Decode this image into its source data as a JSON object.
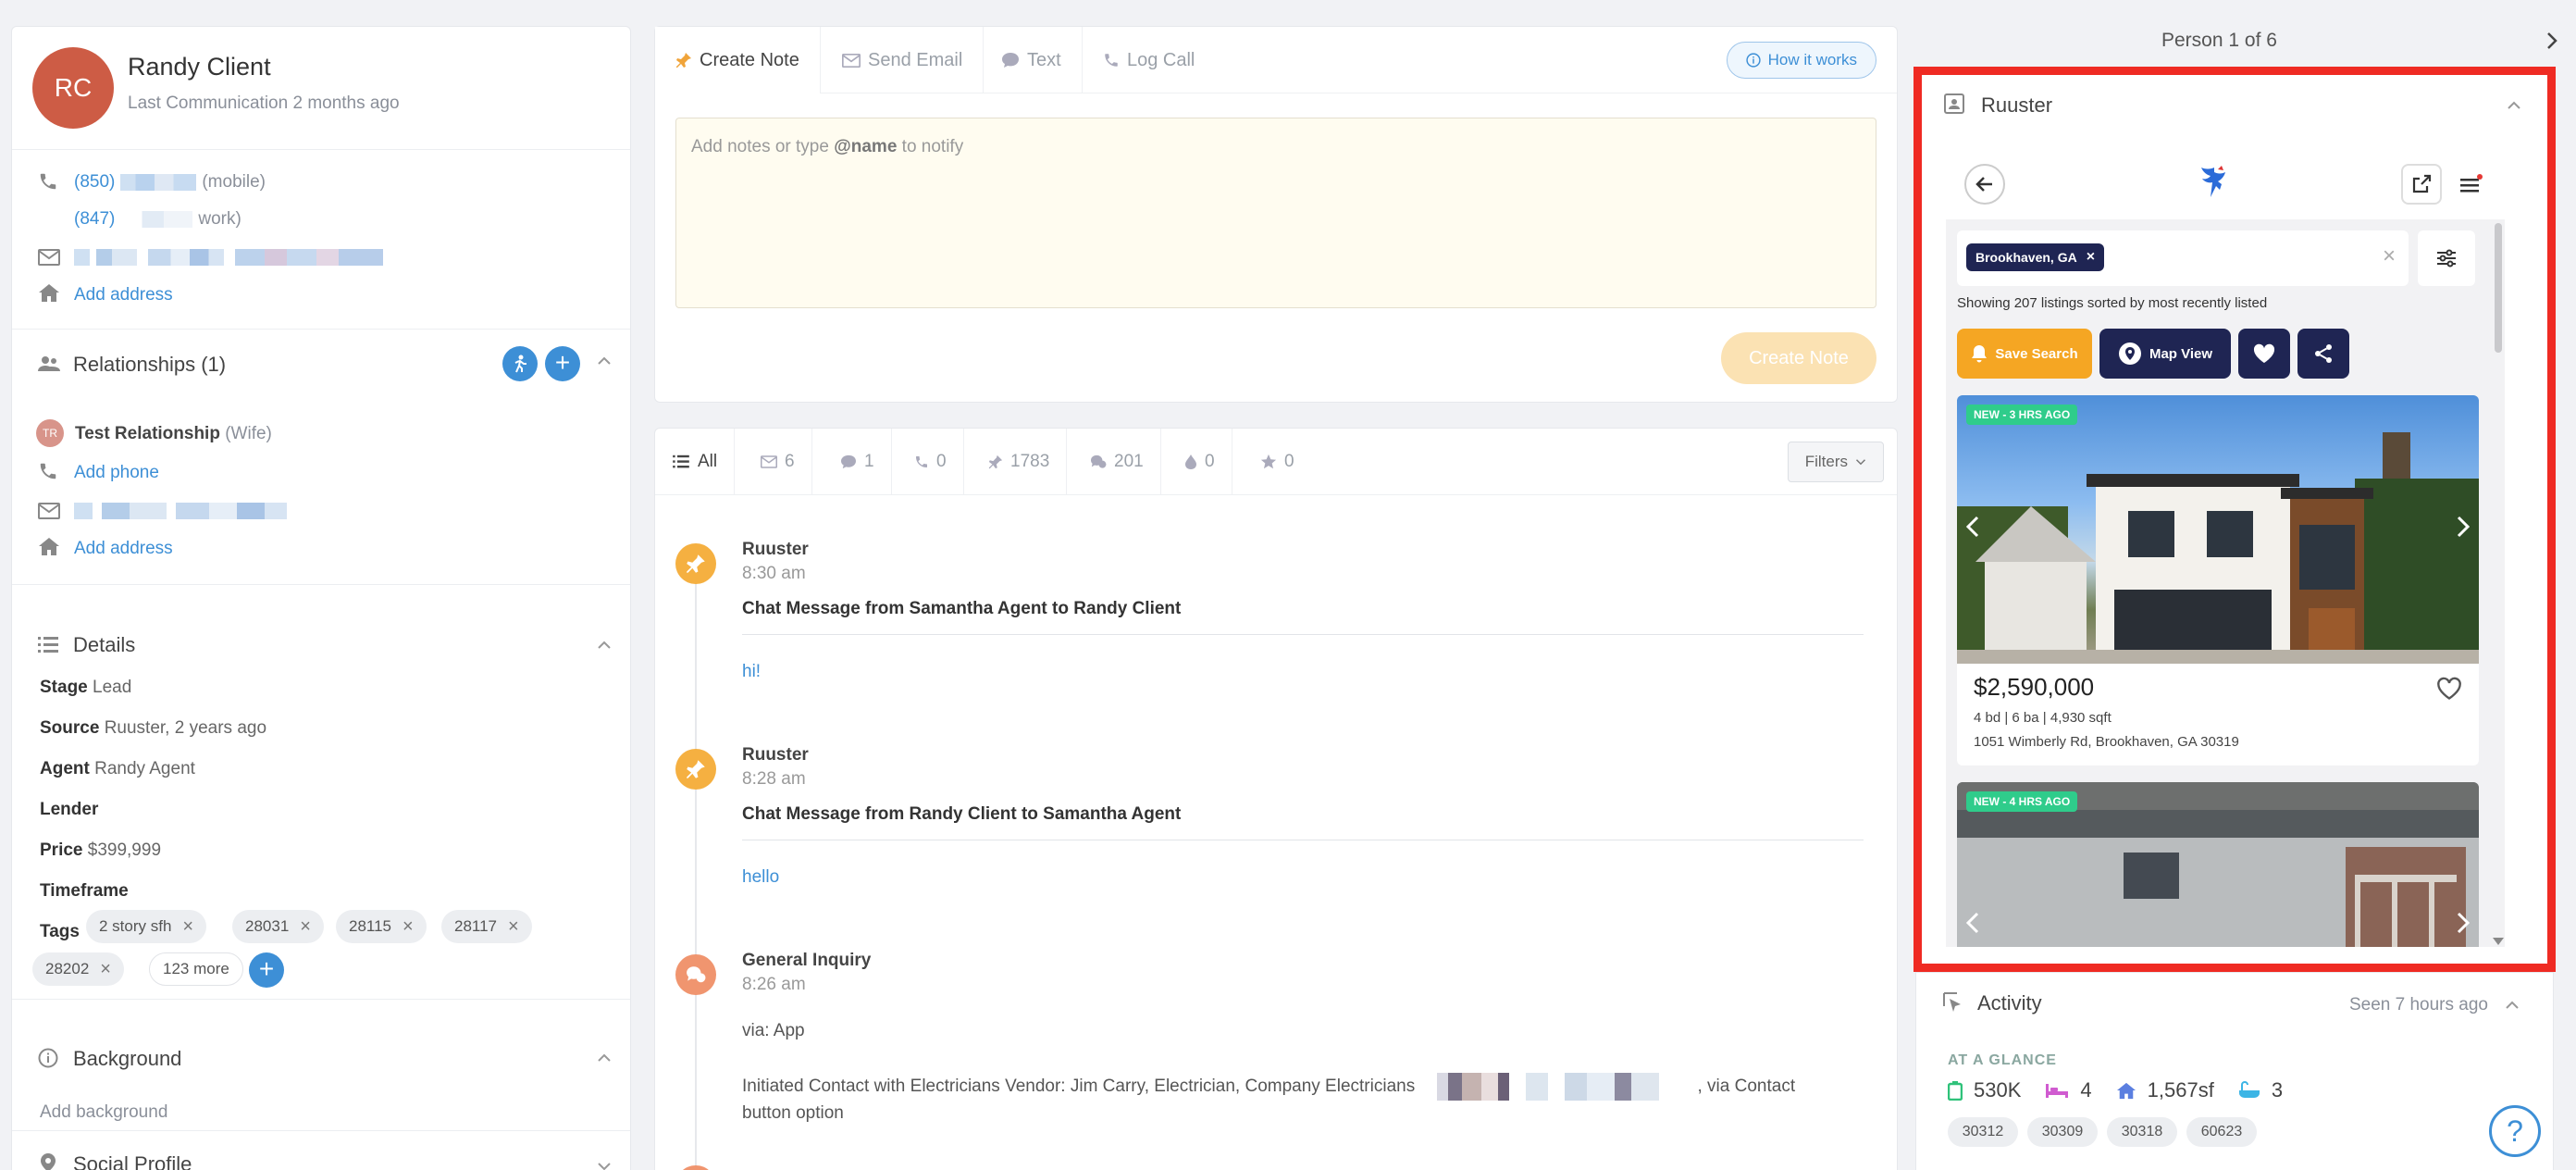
{
  "contact": {
    "initials": "RC",
    "name": "Randy Client",
    "last_comm": "Last Communication 2 months ago",
    "phone1_area": "(850)",
    "phone1_type": "(mobile)",
    "phone2_area": "(847)",
    "phone2_type": "work)",
    "add_address": "Add address"
  },
  "relationships": {
    "title": "Relationships (1)",
    "initials": "TR",
    "name": "Test Relationship",
    "role": "(Wife)",
    "add_phone": "Add phone",
    "add_address": "Add address"
  },
  "details": {
    "title": "Details",
    "stage_label": "Stage",
    "stage_value": "Lead",
    "source_label": "Source",
    "source_value": "Ruuster, 2 years ago",
    "agent_label": "Agent",
    "agent_value": "Randy Agent",
    "lender_label": "Lender",
    "price_label": "Price",
    "price_value": "$399,999",
    "timeframe_label": "Timeframe",
    "tags_label": "Tags",
    "tags": [
      "2 story sfh",
      "28031",
      "28115",
      "28117",
      "28202"
    ],
    "more": "123 more"
  },
  "background": {
    "title": "Background",
    "add": "Add background"
  },
  "social": {
    "title": "Social Profile"
  },
  "note_tabs": {
    "create_note": "Create Note",
    "send_email": "Send Email",
    "text": "Text",
    "log_call": "Log Call",
    "how": "How it works"
  },
  "note": {
    "placeholder_pre": "Add notes or type ",
    "placeholder_bold": "@name",
    "placeholder_post": " to notify",
    "button": "Create Note"
  },
  "feed_tabs": {
    "all": "All",
    "email": "6",
    "chat": "1",
    "call": "0",
    "note": "1783",
    "event": "201",
    "drop": "0",
    "star": "0",
    "filters": "Filters"
  },
  "events": [
    {
      "source": "Ruuster",
      "time": "8:30 am",
      "heading": "Chat Message from Samantha Agent to Randy Client",
      "body": "hi!"
    },
    {
      "source": "Ruuster",
      "time": "8:28 am",
      "heading": "Chat Message from Randy Client to Samantha Agent",
      "body": "hello"
    },
    {
      "source": "General Inquiry",
      "time": "8:26 am",
      "via": "via: App",
      "body_pre": "Initiated Contact with Electricians Vendor: Jim Carry, Electrician, Company Electricians",
      "body_post": ", via Contact",
      "body_line2": "button option"
    }
  ],
  "nav": {
    "person": "Person 1 of 6"
  },
  "ruuster": {
    "title": "Ruuster",
    "chip": "Brookhaven, GA",
    "showing": "Showing 207 listings sorted by most recently listed",
    "save_search": "Save Search",
    "map_view": "Map View",
    "listing1": {
      "badge": "NEW - 3 HRS AGO",
      "price": "$2,590,000",
      "specs": "4 bd | 6 ba | 4,930 sqft",
      "address": "1051 Wimberly Rd, Brookhaven, GA 30319"
    },
    "listing2": {
      "badge": "NEW - 4 HRS AGO"
    }
  },
  "activity": {
    "title": "Activity",
    "seen": "Seen 7 hours ago",
    "glance": "AT A GLANCE",
    "price": "530K",
    "beds": "4",
    "sqft": "1,567sf",
    "baths": "3",
    "zips": [
      "30312",
      "30309",
      "30318",
      "60623"
    ]
  },
  "colors": {
    "accent": "#3d8fd6",
    "avatar": "#cd5c45",
    "orange": "#f5b041",
    "navy": "#1f2553",
    "highlight": "#ef2b23"
  }
}
